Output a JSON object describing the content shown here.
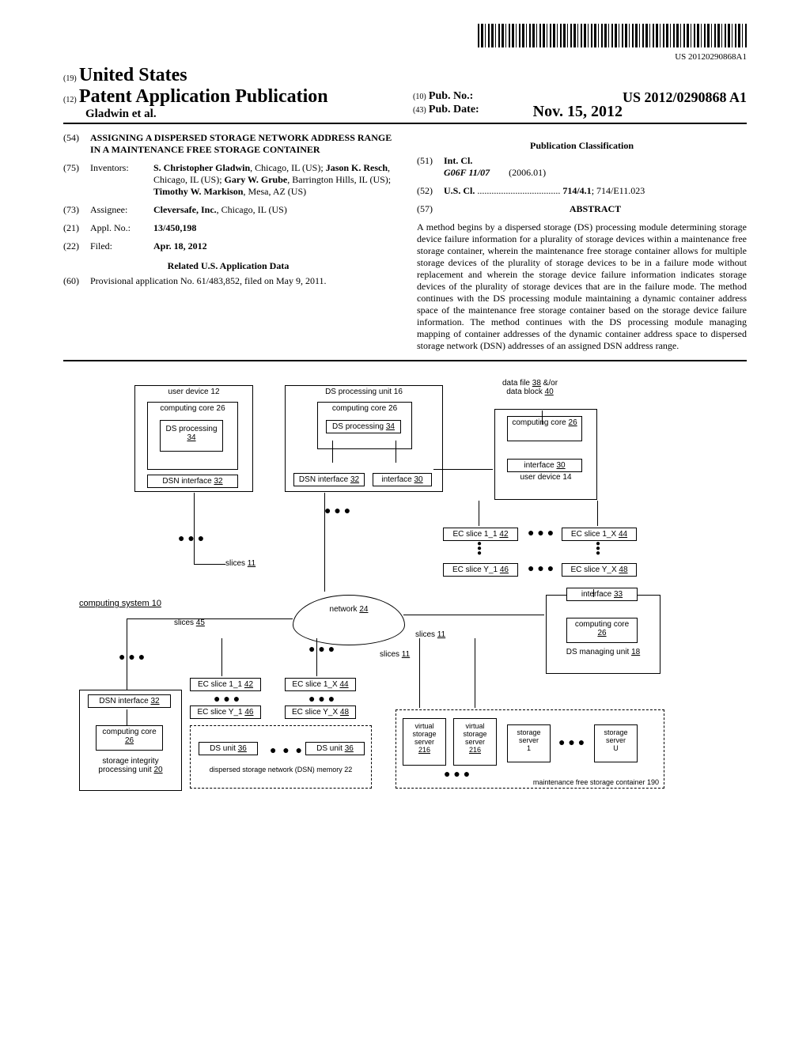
{
  "barcode_number": "US 20120290868A1",
  "header": {
    "code19": "(19)",
    "country": "United States",
    "code12": "(12)",
    "pub_type": "Patent Application Publication",
    "authors_line": "Gladwin et al.",
    "code10": "(10)",
    "pub_no_label": "Pub. No.:",
    "pub_no": "US 2012/0290868 A1",
    "code43": "(43)",
    "pub_date_label": "Pub. Date:",
    "pub_date": "Nov. 15, 2012"
  },
  "fields": {
    "54": {
      "code": "(54)",
      "title": "ASSIGNING A DISPERSED STORAGE NETWORK ADDRESS RANGE IN A MAINTENANCE FREE STORAGE CONTAINER"
    },
    "75": {
      "code": "(75)",
      "label": "Inventors:",
      "value": "S. Christopher Gladwin, Chicago, IL (US); Jason K. Resch, Chicago, IL (US); Gary W. Grube, Barrington Hills, IL (US); Timothy W. Markison, Mesa, AZ (US)"
    },
    "73": {
      "code": "(73)",
      "label": "Assignee:",
      "value": "Cleversafe, Inc., Chicago, IL (US)"
    },
    "21": {
      "code": "(21)",
      "label": "Appl. No.:",
      "value": "13/450,198"
    },
    "22": {
      "code": "(22)",
      "label": "Filed:",
      "value": "Apr. 18, 2012"
    },
    "related_head": "Related U.S. Application Data",
    "60": {
      "code": "(60)",
      "value": "Provisional application No. 61/483,852, filed on May 9, 2011."
    },
    "classification_head": "Publication Classification",
    "51": {
      "code": "(51)",
      "label": "Int. Cl.",
      "cls": "G06F 11/07",
      "edition": "(2006.01)"
    },
    "52": {
      "code": "(52)",
      "label": "U.S. Cl.",
      "value": "714/4.1; 714/E11.023"
    },
    "57": {
      "code": "(57)",
      "label": "ABSTRACT"
    }
  },
  "abstract": "A method begins by a dispersed storage (DS) processing module determining storage device failure information for a plurality of storage devices within a maintenance free storage container, wherein the maintenance free storage container allows for multiple storage devices of the plurality of storage devices to be in a failure mode without replacement and wherein the storage device failure information indicates storage devices of the plurality of storage devices that are in the failure mode. The method continues with the DS processing module maintaining a dynamic container address space of the maintenance free storage container based on the storage device failure information. The method continues with the DS processing module managing mapping of container addresses of the dynamic container address space to dispersed storage network (DSN) addresses of an assigned DSN address range.",
  "figure": {
    "user_device_12": "user device 12",
    "computing_core_26": "computing core 26",
    "ds_processing_34": "DS processing 34",
    "dsn_interface_32": "DSN interface 32",
    "ds_processing_unit_16": "DS processing unit 16",
    "interface_30": "interface 30",
    "data_file": "data file 38 &/or data block 40",
    "user_device_14": "user device 14",
    "ec_slice_1_1": "EC slice 1_1 42",
    "ec_slice_1_x": "EC slice 1_X 44",
    "ec_slice_y_1": "EC slice Y_1 46",
    "ec_slice_y_x": "EC slice Y_X 48",
    "slices_11": "slices 11",
    "slices_45": "slices 45",
    "computing_system": "computing system 10",
    "network_24": "network 24",
    "interface_33": "interface 33",
    "ds_managing_unit_18": "DS managing unit 18",
    "storage_integrity": "storage integrity processing unit 20",
    "ds_unit_36": "DS unit 36",
    "dsn_memory_22": "dispersed storage network (DSN) memory 22",
    "virtual_storage_server_216": "virtual storage server 216",
    "storage_server_1": "storage server 1",
    "storage_server_u": "storage server U",
    "mfsc_190": "maintenance free storage container 190"
  }
}
